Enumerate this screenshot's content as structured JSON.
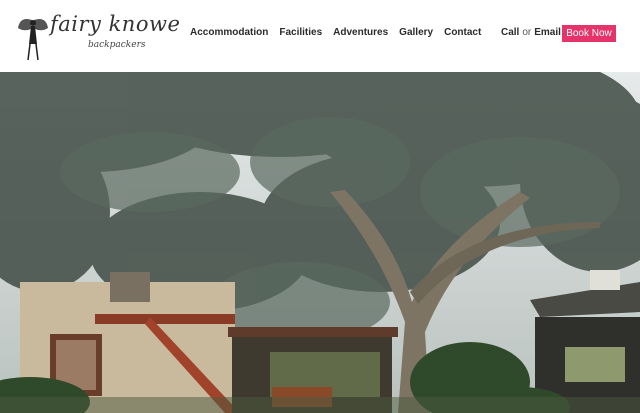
{
  "logo": {
    "main": "fairy knowe",
    "sub": "backpackers",
    "icon": "fairy-icon"
  },
  "nav": {
    "items": [
      {
        "label": "Accommodation"
      },
      {
        "label": "Facilities"
      },
      {
        "label": "Adventures"
      },
      {
        "label": "Gallery"
      },
      {
        "label": "Contact"
      }
    ]
  },
  "contact": {
    "call": "Call",
    "or": "or",
    "email": "Email"
  },
  "book_button": {
    "label": "Book Now",
    "color": "#e5336b"
  },
  "hero": {
    "alt_icon": "hero-photo"
  }
}
